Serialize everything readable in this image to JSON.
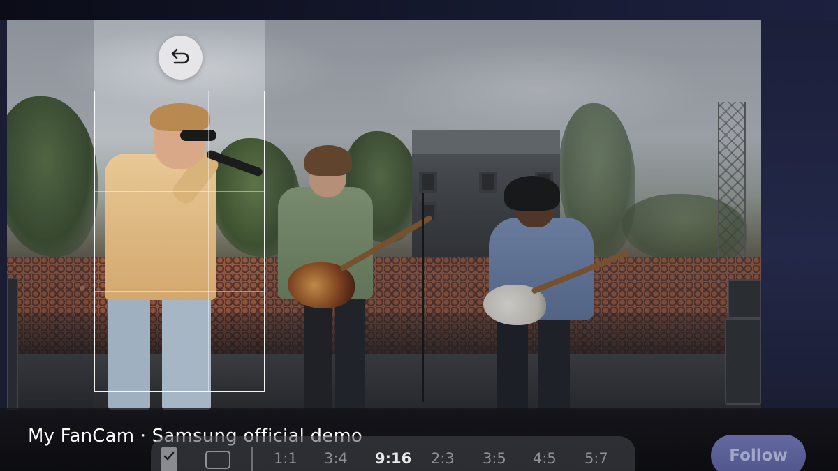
{
  "caption": "My FanCam · Samsung official demo",
  "undo_icon": "undo-arrow-icon",
  "ratios": {
    "r1": "1:1",
    "r2": "3:4",
    "r3": "9:16",
    "r4": "2:3",
    "r5": "3:5",
    "r6": "4:5",
    "r7": "5:7",
    "selected": "9:16"
  },
  "controls": {
    "check_icon": "checkmark-icon",
    "frame_icon": "frame-rectangle-icon"
  },
  "follow_button": "Follow",
  "colors": {
    "follow_bg": "#555b91",
    "active_ratio": "#e8e8ea",
    "inactive_ratio": "#8e9095"
  }
}
